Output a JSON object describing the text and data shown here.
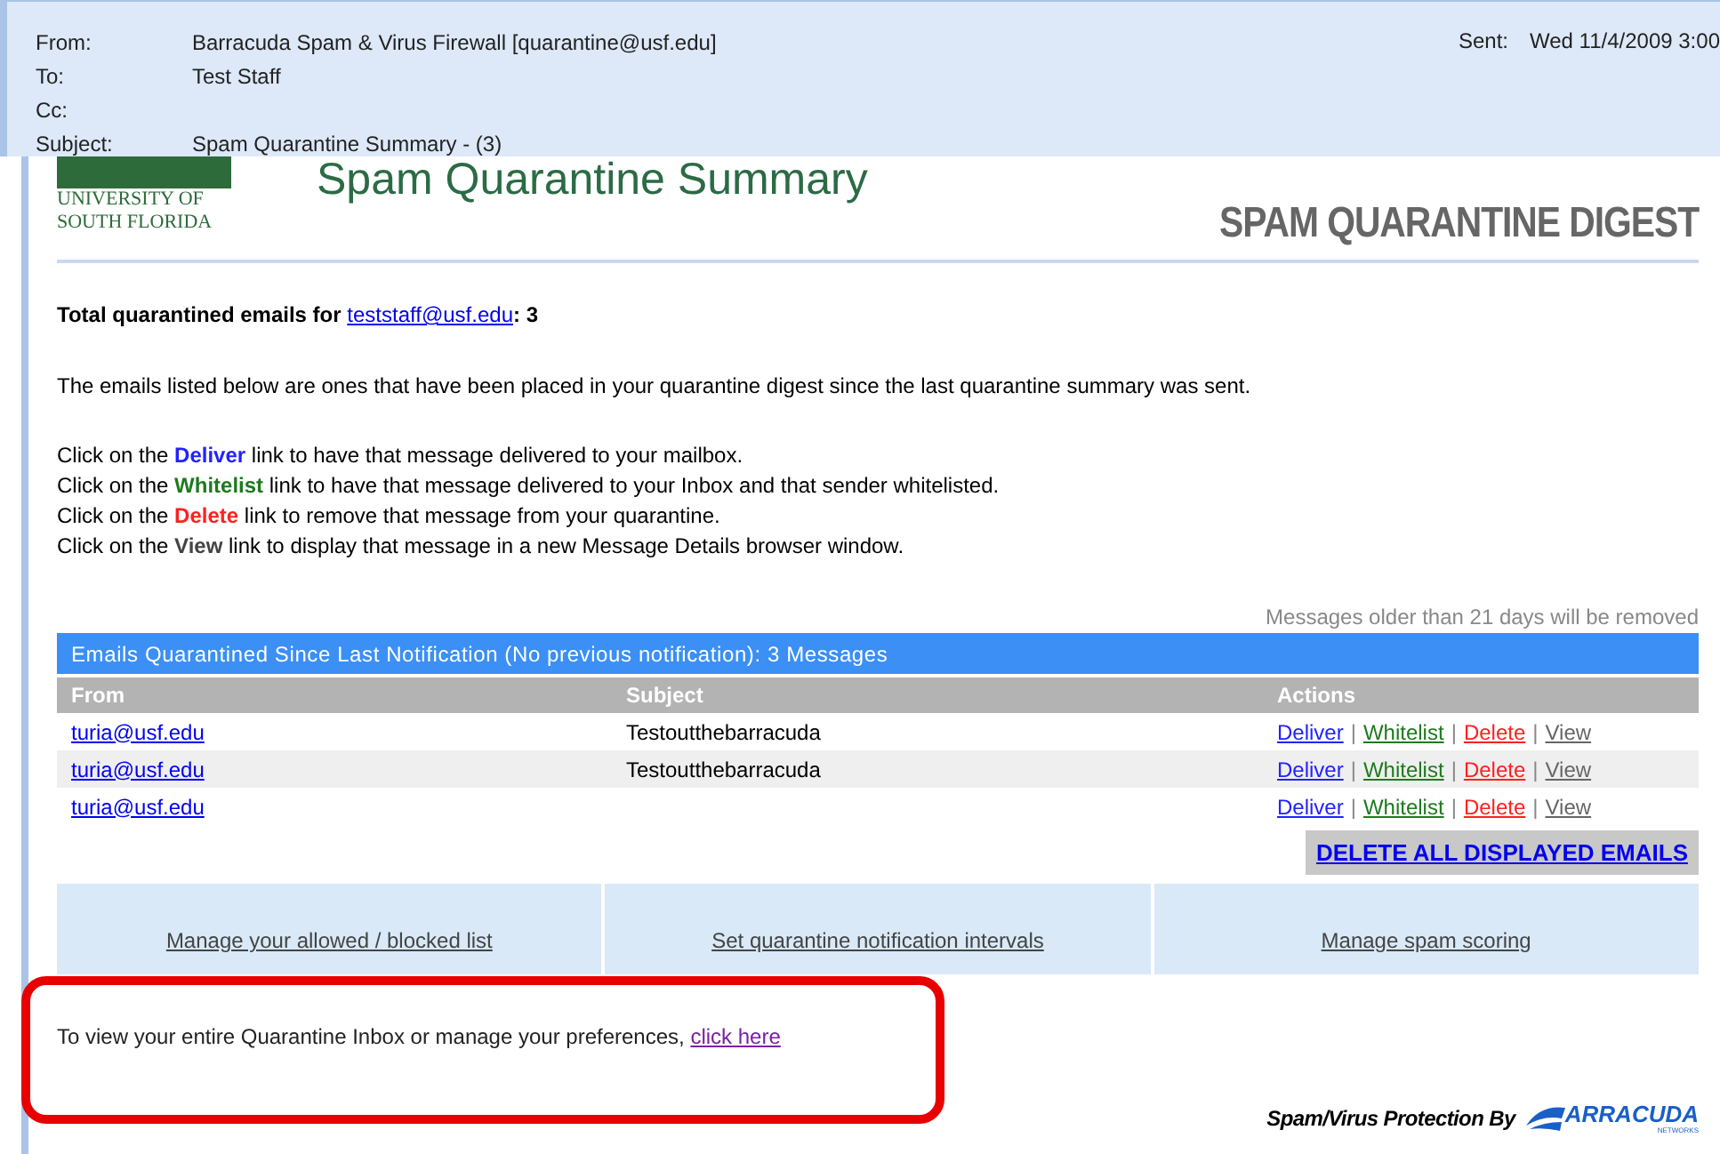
{
  "email_header": {
    "fields": [
      {
        "label": "From:",
        "value": "Barracuda Spam & Virus Firewall [quarantine@usf.edu]"
      },
      {
        "label": "To:",
        "value": "Test Staff"
      },
      {
        "label": "Cc:"
      },
      {
        "label": "Subject:",
        "value": "Spam Quarantine Summary - (3)"
      }
    ],
    "sent_label": "Sent:",
    "sent_value": "Wed 11/4/2009 3:00"
  },
  "banner": {
    "university_line_1": "UNIVERSITY OF",
    "university_line_2": "SOUTH FLORIDA",
    "title": "Spam Quarantine Summary",
    "digest": "SPAM QUARANTINE DIGEST"
  },
  "total": {
    "before": "Total quarantined emails for ",
    "link": "teststaff@usf.edu",
    "after": ": 3"
  },
  "intro": "The emails listed below are ones that have been placed in your quarantine digest since the last quarantine summary was sent.",
  "instructions": [
    {
      "kind": "deliver",
      "before": "Click on the ",
      "keyword": "Deliver",
      "after": " link to have that message delivered to your mailbox."
    },
    {
      "kind": "whitelist",
      "before": "Click on the ",
      "keyword": "Whitelist",
      "after": " link to have that message delivered to your Inbox and that sender whitelisted."
    },
    {
      "kind": "delete",
      "before": "Click on the ",
      "keyword": "Delete",
      "after": " link to remove that message from your quarantine."
    },
    {
      "kind": "view",
      "before": "Click on the ",
      "keyword": "View",
      "after": " link to display that message in a new Message Details browser window."
    }
  ],
  "retention_note": "Messages older than 21 days will be removed",
  "table": {
    "title": "Emails Quarantined Since Last Notification (No previous notification): 3 Messages",
    "columns": [
      "From",
      "Subject",
      "Actions"
    ],
    "rows": [
      {
        "from": "turia@usf.edu",
        "subject": "Testoutthebarracuda",
        "actions": [
          {
            "kind": "deliver",
            "label": "Deliver"
          },
          {
            "kind": "whitelist",
            "label": "Whitelist"
          },
          {
            "kind": "delete",
            "label": "Delete"
          },
          {
            "kind": "view",
            "label": "View"
          }
        ]
      },
      {
        "from": "turia@usf.edu",
        "subject": "Testoutthebarracuda",
        "actions": [
          {
            "kind": "deliver",
            "label": "Deliver"
          },
          {
            "kind": "whitelist",
            "label": "Whitelist"
          },
          {
            "kind": "delete",
            "label": "Delete"
          },
          {
            "kind": "view",
            "label": "View"
          }
        ]
      },
      {
        "from": "turia@usf.edu",
        "actions": [
          {
            "kind": "deliver",
            "label": "Deliver"
          },
          {
            "kind": "whitelist",
            "label": "Whitelist"
          },
          {
            "kind": "delete",
            "label": "Delete"
          },
          {
            "kind": "view",
            "label": "View"
          }
        ]
      }
    ],
    "separator": "|",
    "delete_all": "DELETE ALL DISPLAYED EMAILS"
  },
  "manage_links": [
    "Manage your allowed / blocked list",
    "Set quarantine notification intervals",
    "Manage spam scoring"
  ],
  "preferences": {
    "before": "To view your entire Quarantine Inbox or manage your preferences, ",
    "link": "click here"
  },
  "footer": {
    "protection": "Spam/Virus Protection By",
    "brand": "ARRACUDA",
    "brand_sub": "NETWORKS"
  }
}
